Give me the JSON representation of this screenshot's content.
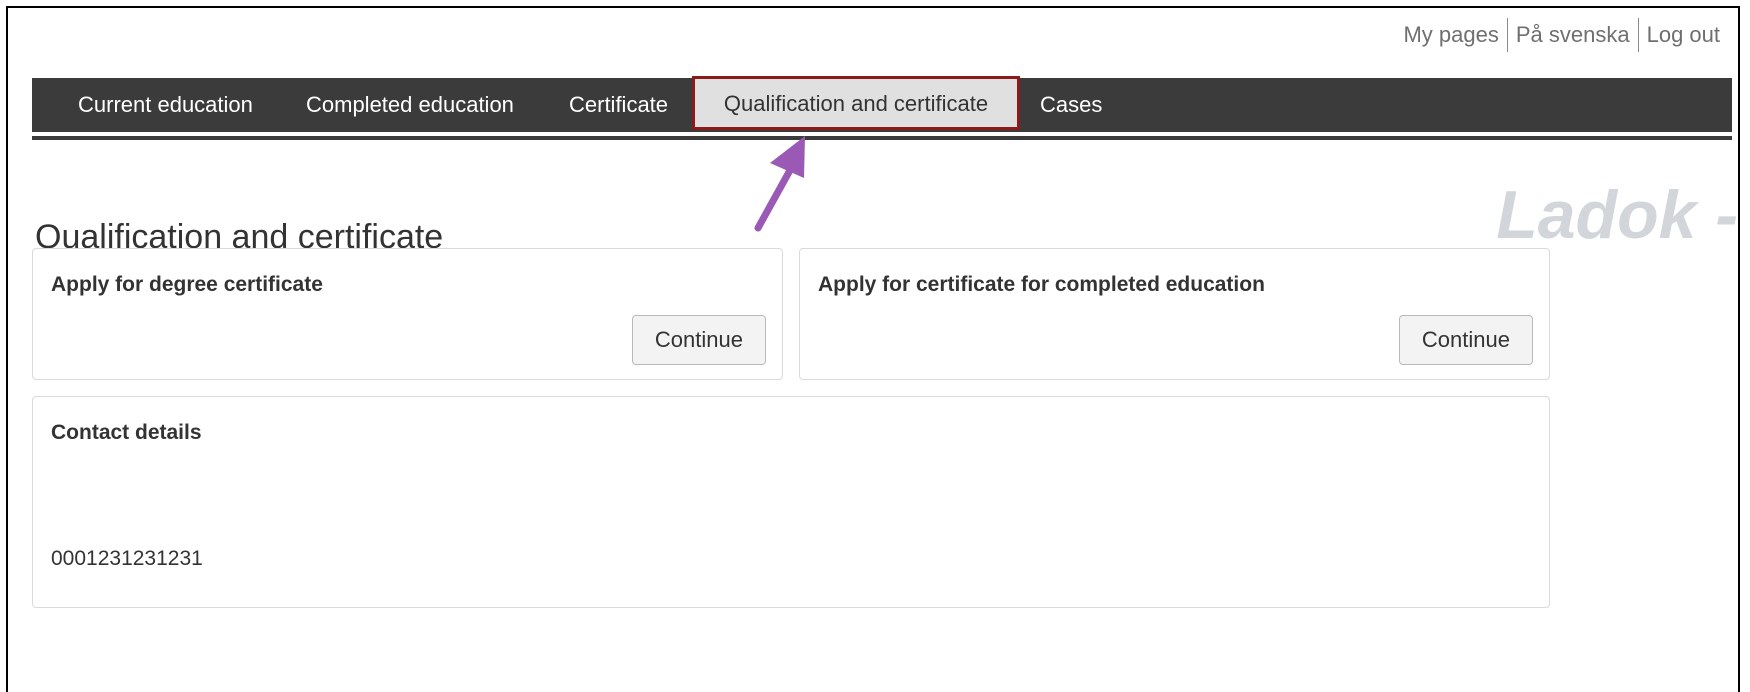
{
  "top_links": {
    "my_pages": "My pages",
    "language": "På svenska",
    "log_out": "Log out"
  },
  "nav": {
    "items": [
      {
        "label": "Current education"
      },
      {
        "label": "Completed education"
      },
      {
        "label": "Certificate"
      },
      {
        "label": "Qualification and certificate",
        "active": true
      },
      {
        "label": "Cases"
      }
    ]
  },
  "branding": {
    "watermark": "Ladok -"
  },
  "page": {
    "title": "Qualification and certificate"
  },
  "panels": {
    "degree": {
      "heading": "Apply for degree certificate",
      "button_label": "Continue"
    },
    "completed": {
      "heading": "Apply for certificate for completed education",
      "button_label": "Continue"
    },
    "contact": {
      "heading": "Contact details",
      "phone": "0001231231231"
    }
  },
  "annotation": {
    "arrow_color": "#9b59b6",
    "highlight_color": "#8b1a1a"
  },
  "colors": {
    "nav_background": "#3b3b3b",
    "active_tab_background": "#e0e0e0"
  }
}
